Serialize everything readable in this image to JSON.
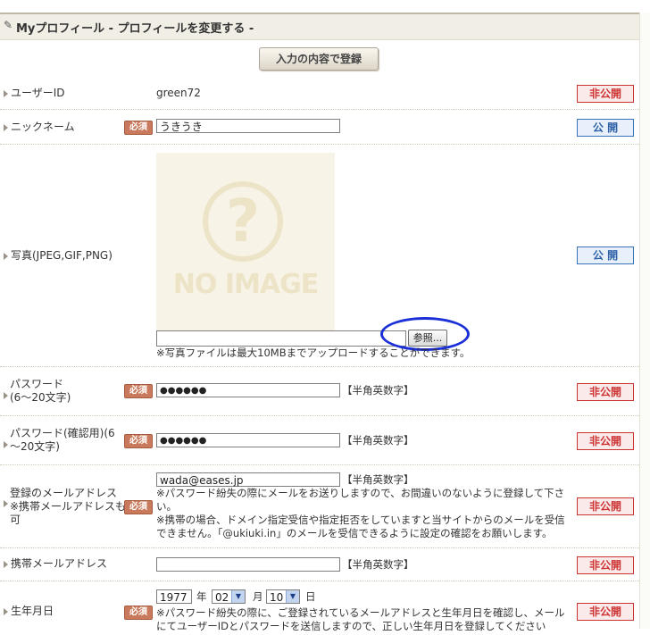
{
  "page": {
    "title": "Myプロフィール - プロフィールを変更する -",
    "register_button": "入力の内容で登録"
  },
  "badges": {
    "private": "非公開",
    "public": "公 開"
  },
  "required_label": "必須",
  "hankaku": "【半角英数字】",
  "fields": {
    "user_id": {
      "label": "ユーザーID",
      "value": "green72"
    },
    "nickname": {
      "label": "ニックネーム",
      "value": "うきうき"
    },
    "photo": {
      "label": "写真(JPEG,GIF,PNG)",
      "noimage_text": "NO IMAGE",
      "browse": "参照...",
      "note": "※写真ファイルは最大10MBまでアップロードすることができます。"
    },
    "password": {
      "label_line1": "パスワード",
      "label_line2": "(6〜20文字)",
      "value": "●●●●●●"
    },
    "password_confirm": {
      "label_line1": "パスワード(確認用)(6",
      "label_line2": "〜20文字)",
      "value": "●●●●●●"
    },
    "email": {
      "label_line1": "登録のメールアドレス",
      "label_line2": "※携帯メールアドレスも",
      "label_line3": "可",
      "value": "wada@eases.jp",
      "note1_line1": "※パスワード紛失の際にメールをお送りしますので、お間違いのないように登録して下さ",
      "note1_line2": "い。",
      "note2_line1": "※携帯の場合、ドメイン指定受信や指定拒否をしていますと当サイトからのメールを受信",
      "note2_line2": "できません。「@ukiuki.in」のメールを受信できるように設定の確認をお願いします。"
    },
    "mobile_email": {
      "label": "携帯メールアドレス",
      "value": ""
    },
    "birthday": {
      "label": "生年月日",
      "year": "1977",
      "year_unit": "年",
      "month": "02",
      "month_unit": "月",
      "day": "10",
      "day_unit": "日",
      "note_line1": "※パスワード紛失の際に、ご登録されているメールアドレスと生年月日を確認し、メール",
      "note_line2": "にてユーザーIDとパスワードを送信しますので、正しい生年月日を登録してください"
    }
  }
}
